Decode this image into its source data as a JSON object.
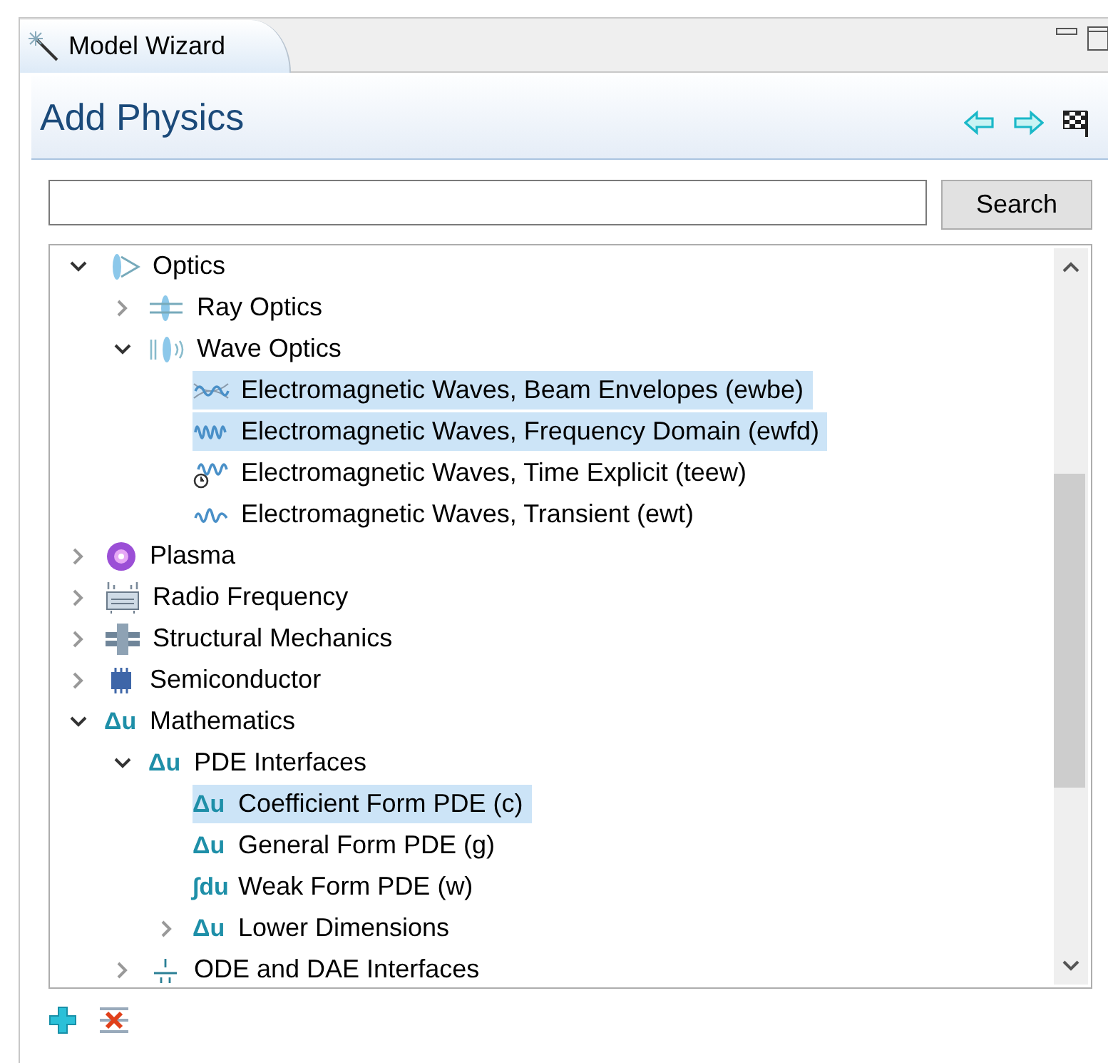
{
  "tab": {
    "label": "Model Wizard"
  },
  "header": {
    "title": "Add Physics"
  },
  "search": {
    "button": "Search"
  },
  "tree": [
    {
      "label": "Optics",
      "kind": "optics",
      "expanded": true,
      "selected": false,
      "children": [
        {
          "label": "Ray Optics",
          "kind": "ray",
          "expanded": false,
          "selected": false
        },
        {
          "label": "Wave Optics",
          "kind": "wave",
          "expanded": true,
          "selected": false,
          "children": [
            {
              "label": "Electromagnetic Waves, Beam Envelopes (ewbe)",
              "kind": "beam",
              "selected": true
            },
            {
              "label": "Electromagnetic Waves, Frequency Domain (ewfd)",
              "kind": "freq",
              "selected": true
            },
            {
              "label": "Electromagnetic Waves, Time Explicit (teew)",
              "kind": "time",
              "selected": false
            },
            {
              "label": "Electromagnetic Waves, Transient (ewt)",
              "kind": "transient",
              "selected": false
            }
          ]
        }
      ]
    },
    {
      "label": "Plasma",
      "kind": "plasma",
      "expanded": false,
      "selected": false
    },
    {
      "label": "Radio Frequency",
      "kind": "radio",
      "expanded": false,
      "selected": false
    },
    {
      "label": "Structural Mechanics",
      "kind": "structural",
      "expanded": false,
      "selected": false
    },
    {
      "label": "Semiconductor",
      "kind": "chip",
      "expanded": false,
      "selected": false
    },
    {
      "label": "Mathematics",
      "kind": "symbol",
      "symbol": "Δu",
      "expanded": true,
      "selected": false,
      "children": [
        {
          "label": "PDE Interfaces",
          "kind": "symbol",
          "symbol": "Δu",
          "expanded": true,
          "selected": false,
          "children": [
            {
              "label": "Coefficient Form PDE (c)",
              "kind": "symbol",
              "symbol": "Δu",
              "selected": true
            },
            {
              "label": "General Form PDE (g)",
              "kind": "symbol",
              "symbol": "Δu",
              "selected": false
            },
            {
              "label": "Weak Form PDE (w)",
              "kind": "symbol",
              "symbol": "∫du",
              "selected": false
            },
            {
              "label": "Lower Dimensions",
              "kind": "symbol",
              "symbol": "Δu",
              "expanded": false,
              "selected": false
            }
          ]
        },
        {
          "label": "ODE and DAE Interfaces",
          "kind": "ode",
          "expanded": false,
          "selected": false
        }
      ]
    }
  ]
}
